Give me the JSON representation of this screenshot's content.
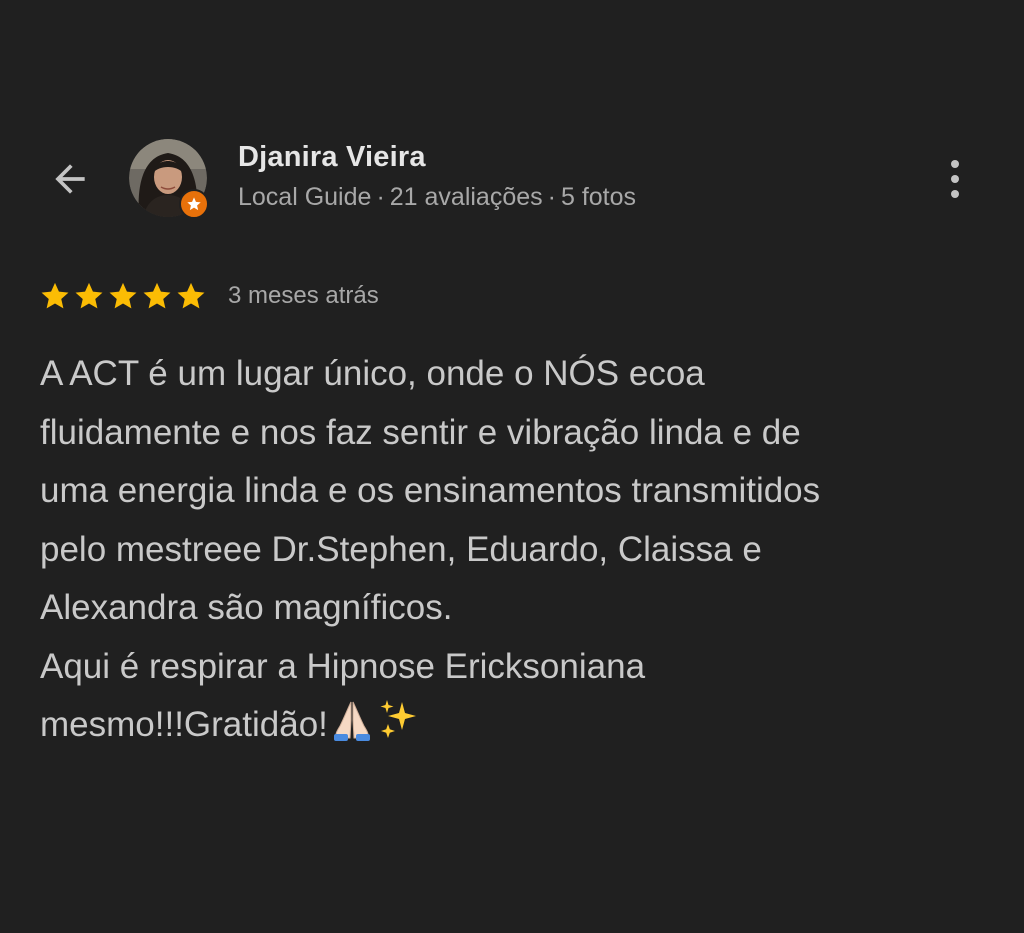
{
  "header": {
    "user_name": "Djanira Vieira",
    "meta": {
      "role": "Local Guide",
      "reviews": "21 avaliações",
      "photos": "5 fotos",
      "separator": "·"
    },
    "avatar_badge_icon": "star-icon"
  },
  "review": {
    "rating": 5,
    "rating_max": 5,
    "date": "3 meses atrás",
    "lines": [
      "A ACT é um lugar único, onde o NÓS ecoa",
      "fluidamente e nos faz sentir e vibração linda e de",
      "uma energia linda e os ensinamentos transmitidos",
      "pelo mestreee Dr.Stephen, Eduardo, Claissa e",
      "Alexandra são magníficos.",
      "Aqui é respirar a Hipnose Ericksoniana",
      "mesmo!!!Gratidão!"
    ],
    "trailing_emoji": [
      "folded-hands-emoji",
      "sparkles-emoji"
    ]
  },
  "colors": {
    "background": "#202020",
    "star": "#fbbc04",
    "guide_badge": "#e8710a",
    "name": "#e6e6e6",
    "meta": "#a8a8a8",
    "body_text": "#c9c9c9"
  }
}
